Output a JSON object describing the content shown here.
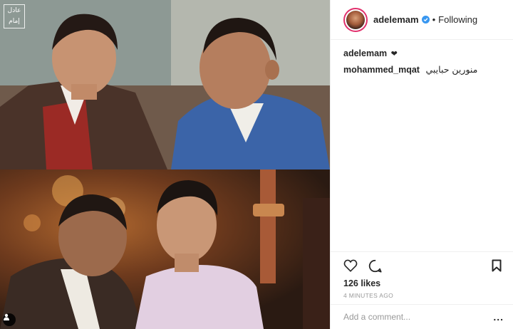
{
  "post": {
    "watermark_line1": "عادل",
    "watermark_line2": "إمام",
    "header": {
      "username": "adelemam",
      "separator": "•",
      "follow_state": "Following",
      "verified_icon": "verified-badge-icon"
    },
    "comments": [
      {
        "user": "adelemam",
        "text": "❤"
      },
      {
        "user": "mohammed_mqat",
        "text": "منورين حبايبي"
      }
    ],
    "actions": {
      "like_icon": "heart-icon",
      "comment_icon": "comment-bubble-icon",
      "save_icon": "bookmark-icon"
    },
    "likes_text": "126 likes",
    "timestamp": "4 MINUTES AGO",
    "add_comment": {
      "placeholder": "Add a comment...",
      "more_label": "..."
    }
  },
  "colors": {
    "verified": "#3897f0",
    "avatar_ring": "#e1306c",
    "secondary_text": "#999999",
    "divider": "#efefef"
  }
}
